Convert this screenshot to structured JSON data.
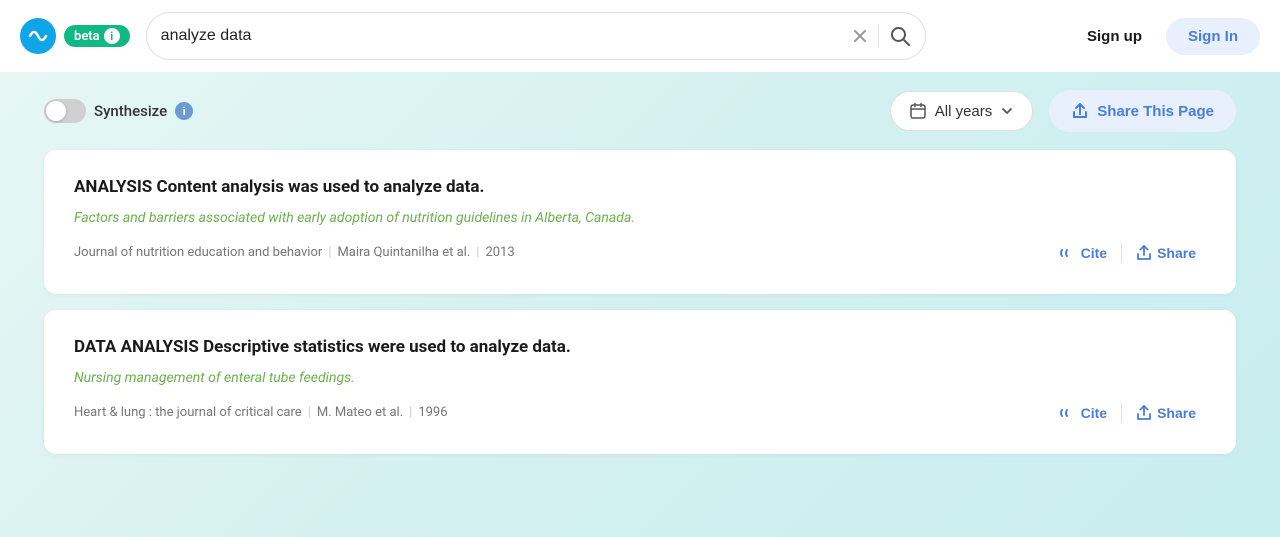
{
  "header": {
    "logo_alt": "Consensus",
    "beta_label": "beta",
    "beta_info": "i",
    "search_value": "analyze data",
    "signup_label": "Sign up",
    "signin_label": "Sign In"
  },
  "toolbar": {
    "synthesize_label": "Synthesize",
    "info_label": "i",
    "all_years_label": "All years",
    "share_page_label": "Share This Page"
  },
  "results": [
    {
      "title": "ANALYSIS Content analysis was used to analyze data.",
      "subtitle": "Factors and barriers associated with early adoption of nutrition guidelines in Alberta, Canada.",
      "journal": "Journal of nutrition education and behavior",
      "authors": "Maira Quintanilha et al.",
      "year": "2013",
      "cite_label": "Cite",
      "share_label": "Share"
    },
    {
      "title": "DATA ANALYSIS Descriptive statistics were used to analyze data.",
      "subtitle": "Nursing management of enteral tube feedings.",
      "journal": "Heart & lung : the journal of critical care",
      "authors": "M. Mateo et al.",
      "year": "1996",
      "cite_label": "Cite",
      "share_label": "Share"
    }
  ]
}
